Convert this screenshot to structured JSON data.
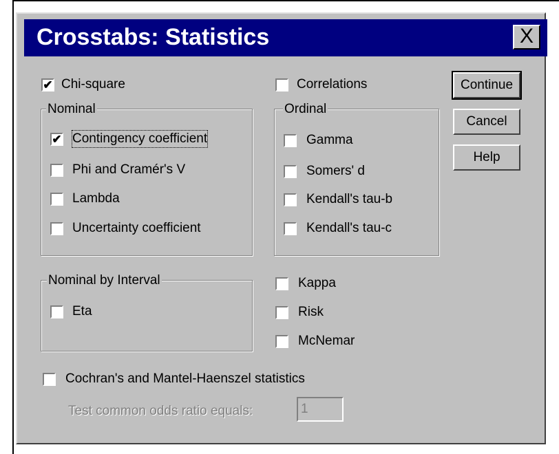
{
  "window": {
    "title": "Crosstabs: Statistics",
    "close_label": "X"
  },
  "checks": {
    "chi_square": {
      "label": "Chi-square",
      "checked": true
    },
    "correlations": {
      "label": "Correlations",
      "checked": false
    }
  },
  "nominal": {
    "legend": "Nominal",
    "items": [
      {
        "label": "Contingency coefficient",
        "checked": true
      },
      {
        "label": "Phi and Cramér's V",
        "checked": false
      },
      {
        "label": "Lambda",
        "checked": false
      },
      {
        "label": "Uncertainty coefficient",
        "checked": false
      }
    ]
  },
  "ordinal": {
    "legend": "Ordinal",
    "items": [
      {
        "label": "Gamma",
        "checked": false
      },
      {
        "label": "Somers' d",
        "checked": false
      },
      {
        "label": "Kendall's tau-b",
        "checked": false
      },
      {
        "label": "Kendall's tau-c",
        "checked": false
      }
    ]
  },
  "nominal_by_interval": {
    "legend": "Nominal by Interval",
    "items": [
      {
        "label": "Eta",
        "checked": false
      }
    ]
  },
  "other": {
    "items": [
      {
        "label": "Kappa",
        "checked": false
      },
      {
        "label": "Risk",
        "checked": false
      },
      {
        "label": "McNemar",
        "checked": false
      }
    ]
  },
  "cochran": {
    "label": "Cochran's and Mantel-Haenszel statistics",
    "checked": false
  },
  "odds": {
    "label": "Test common odds ratio equals:",
    "value": "1"
  },
  "buttons": {
    "continue": "Continue",
    "cancel": "Cancel",
    "help": "Help"
  },
  "check_mark": "✔"
}
